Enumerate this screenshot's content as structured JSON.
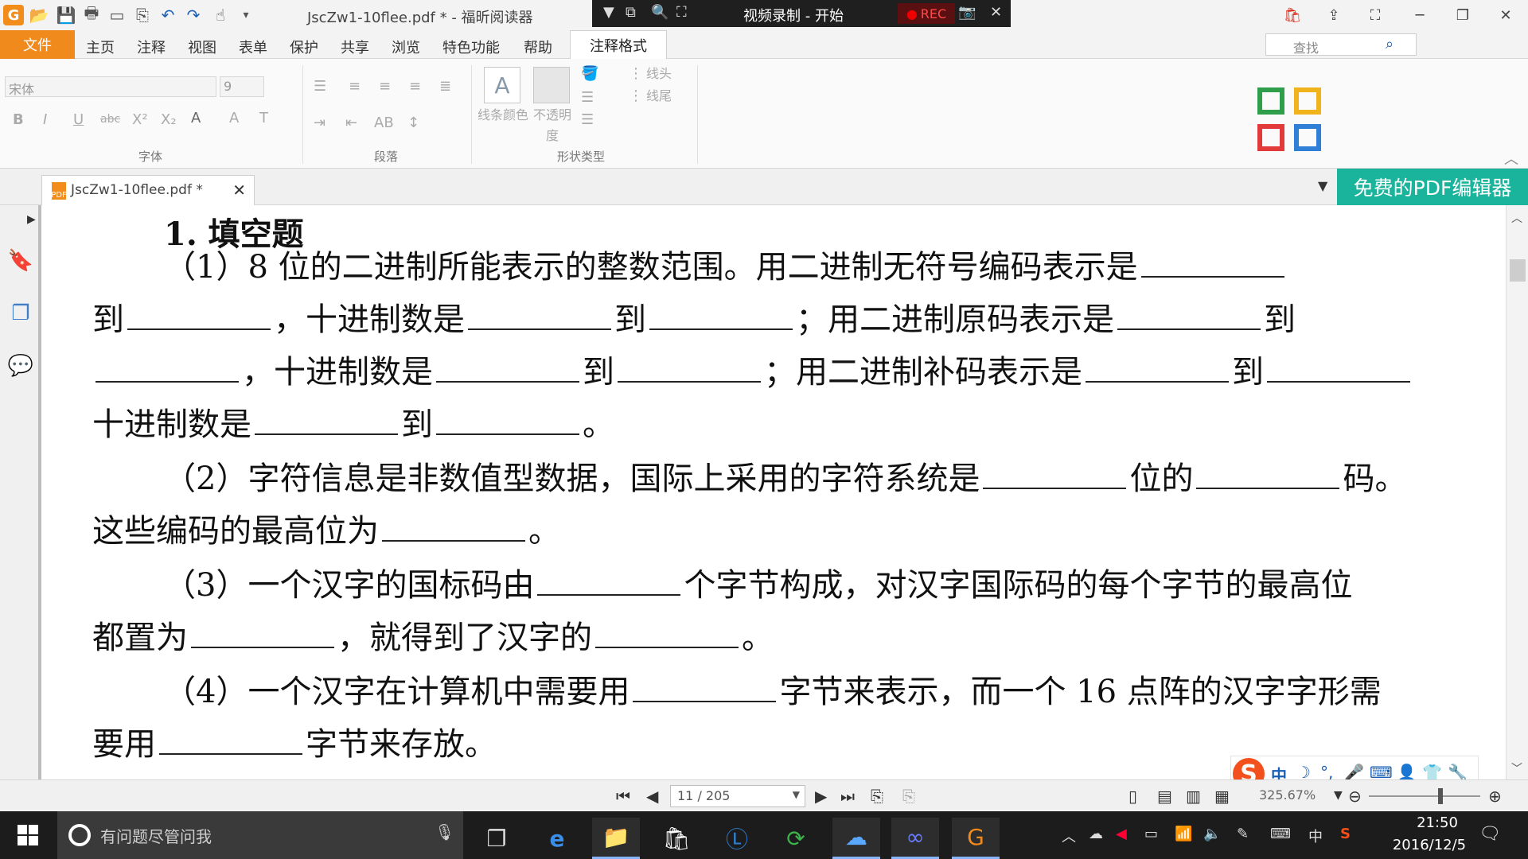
{
  "titlebar": {
    "doc_title": "JscZw1-10flee.pdf * - 福昕阅读器",
    "icons": [
      "app-logo-icon",
      "open-icon",
      "save-icon",
      "print-icon",
      "scan-icon",
      "new-icon",
      "undo-icon",
      "redo-icon",
      "hand-tool-icon",
      "customize-icon"
    ]
  },
  "recorder": {
    "title": "视频录制 - 开始",
    "rec_label": "REC"
  },
  "menu": {
    "file": "文件",
    "items": [
      "主页",
      "注释",
      "视图",
      "表单",
      "保护",
      "共享",
      "浏览",
      "特色功能",
      "帮助"
    ],
    "active_tab": "注释格式",
    "search_placeholder": "查找"
  },
  "ribbon": {
    "font_name": "宋体",
    "font_size": "9",
    "group_font": "字体",
    "group_paragraph": "段落",
    "group_shape": "形状类型",
    "line_color": "线条颜色",
    "opacity": "不透明度",
    "line_head": "线头",
    "line_tail": "线尾"
  },
  "tabs": {
    "doc_tab_label": "JscZw1-10flee.pdf *",
    "promo": "免费的PDF编辑器"
  },
  "document": {
    "heading": "1. 填空题",
    "lines": [
      {
        "text_a": "（1）8 位的二进制所能表示的整数范围。用二进制无符号编码表示是",
        "text_b": "",
        "text_c": "",
        "text_d": "",
        "text_e": ""
      },
      {
        "text_a": "到",
        "text_b": "，十进制数是",
        "text_c": "到",
        "text_d": "；用二进制原码表示是",
        "text_e": "到"
      },
      {
        "text_a": "",
        "text_b": "，十进制数是",
        "text_c": "到",
        "text_d": "；用二进制补码表示是",
        "text_e": "到"
      },
      {
        "text_a": "十进制数是",
        "text_b": "到",
        "text_c": "。",
        "text_d": "",
        "text_e": ""
      },
      {
        "text_a": "（2）字符信息是非数值型数据，国际上采用的字符系统是",
        "text_b": "位的",
        "text_c": "码。",
        "text_d": "",
        "text_e": ""
      },
      {
        "text_a": "这些编码的最高位为",
        "text_b": "。",
        "text_c": "",
        "text_d": "",
        "text_e": ""
      },
      {
        "text_a": "（3）一个汉字的国标码由",
        "text_b": "个字节构成，对汉字国际码的每个字节的最高位",
        "text_c": "",
        "text_d": "",
        "text_e": ""
      },
      {
        "text_a": "都置为",
        "text_b": "，就得到了汉字的",
        "text_c": "。",
        "text_d": "",
        "text_e": ""
      },
      {
        "text_a": "（4）一个汉字在计算机中需要用",
        "text_b": "字节来表示，而一个 16 点阵的汉字字形需",
        "text_c": "",
        "text_d": "",
        "text_e": ""
      },
      {
        "text_a": "要用",
        "text_b": "字节来存放。",
        "text_c": "",
        "text_d": "",
        "text_e": ""
      }
    ]
  },
  "statusbar": {
    "page": "11 / 205",
    "zoom": "325.67%",
    "zoom_fraction": 0.64
  },
  "taskbar": {
    "search_placeholder": "有问题尽管问我",
    "time": "21:50",
    "date": "2016/12/5",
    "ime_lang": "中",
    "apps": [
      "task-view-icon",
      "edge-icon",
      "file-explorer-icon",
      "store-icon",
      "l-app-icon",
      "green-app-icon",
      "cloud-app-icon",
      "infinity-app-icon",
      "foxit-reader-icon"
    ]
  },
  "colors": {
    "accent_orange": "#f08a1c",
    "promo_green": "#1ab39b",
    "taskbar": "#1c1c1c",
    "rec_red": "#ff4a4a"
  }
}
